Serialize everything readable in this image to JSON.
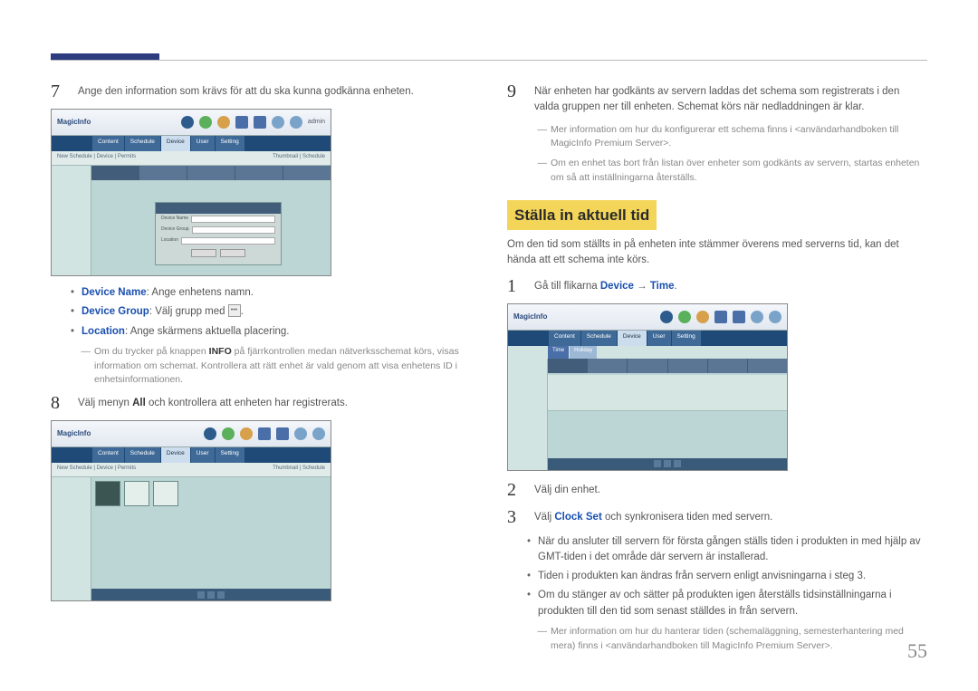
{
  "page_number": "55",
  "left": {
    "step7": {
      "num": "7",
      "text": "Ange den information som krävs för att du ska kunna godkänna enheten."
    },
    "bullets": {
      "device_name_label": "Device Name",
      "device_name_text": ": Ange enhetens namn.",
      "device_group_label": "Device Group",
      "device_group_text": ": Välj grupp med ",
      "device_group_tail": ".",
      "location_label": "Location",
      "location_text": ": Ange skärmens aktuella placering."
    },
    "note_info_a": "Om du trycker på knappen ",
    "note_info_bold": "INFO",
    "note_info_b": " på fjärrkontrollen medan nätverksschemat körs, visas information om schemat. Kontrollera att rätt enhet är vald genom att visa enhetens ID i enhetsinformationen.",
    "step8": {
      "num": "8",
      "text_a": "Välj menyn ",
      "text_bold": "All",
      "text_b": " och kontrollera att enheten har registrerats."
    },
    "app": {
      "brand": "MagicInfo",
      "admin": "admin",
      "tabs": [
        "Content",
        "Schedule",
        "Device",
        "User",
        "Setting"
      ],
      "subleft": "New Schedule | Device | Permits",
      "subright": "Thumbnail | Schedule",
      "dialog_fields": [
        "Device Name",
        "Device Group",
        "Location"
      ]
    }
  },
  "right": {
    "step9": {
      "num": "9",
      "text": "När enheten har godkänts av servern laddas det schema som registrerats i den valda gruppen ner till enheten. Schemat körs när nedladdningen är klar."
    },
    "note1": "Mer information om hur du konfigurerar ett schema finns i <användarhandboken till MagicInfo Premium Server>.",
    "note2": "Om en enhet tas bort från listan över enheter som godkänts av servern, startas enheten om så att inställningarna återställs.",
    "section_title": "Ställa in aktuell tid",
    "intro": "Om den tid som ställts in på enheten inte stämmer överens med serverns tid, kan det hända att ett schema inte körs.",
    "step1": {
      "num": "1",
      "text_a": "Gå till flikarna ",
      "dev": "Device",
      "arrow": " → ",
      "time": "Time",
      "tail": "."
    },
    "step2": {
      "num": "2",
      "text": "Välj din enhet."
    },
    "step3": {
      "num": "3",
      "text_a": "Välj ",
      "bold": "Clock Set",
      "text_b": " och synkronisera tiden med servern."
    },
    "bullets": {
      "b1": "När du ansluter till servern för första gången ställs tiden i produkten in med hjälp av GMT-tiden i det område där servern är installerad.",
      "b2": "Tiden i produkten kan ändras från servern enligt anvisningarna i steg 3.",
      "b3": "Om du stänger av och sätter på produkten igen återställs tidsinställningarna i produkten till den tid som senast ställdes in från servern."
    },
    "note3": "Mer information om hur du hanterar tiden (schemaläggning, semesterhantering med mera) finns i <användarhandboken till MagicInfo Premium Server>.",
    "app": {
      "brand": "MagicInfo",
      "tabs": [
        "Content",
        "Schedule",
        "Device",
        "User",
        "Setting"
      ],
      "subtabs": [
        "Time",
        "Holiday"
      ]
    }
  }
}
